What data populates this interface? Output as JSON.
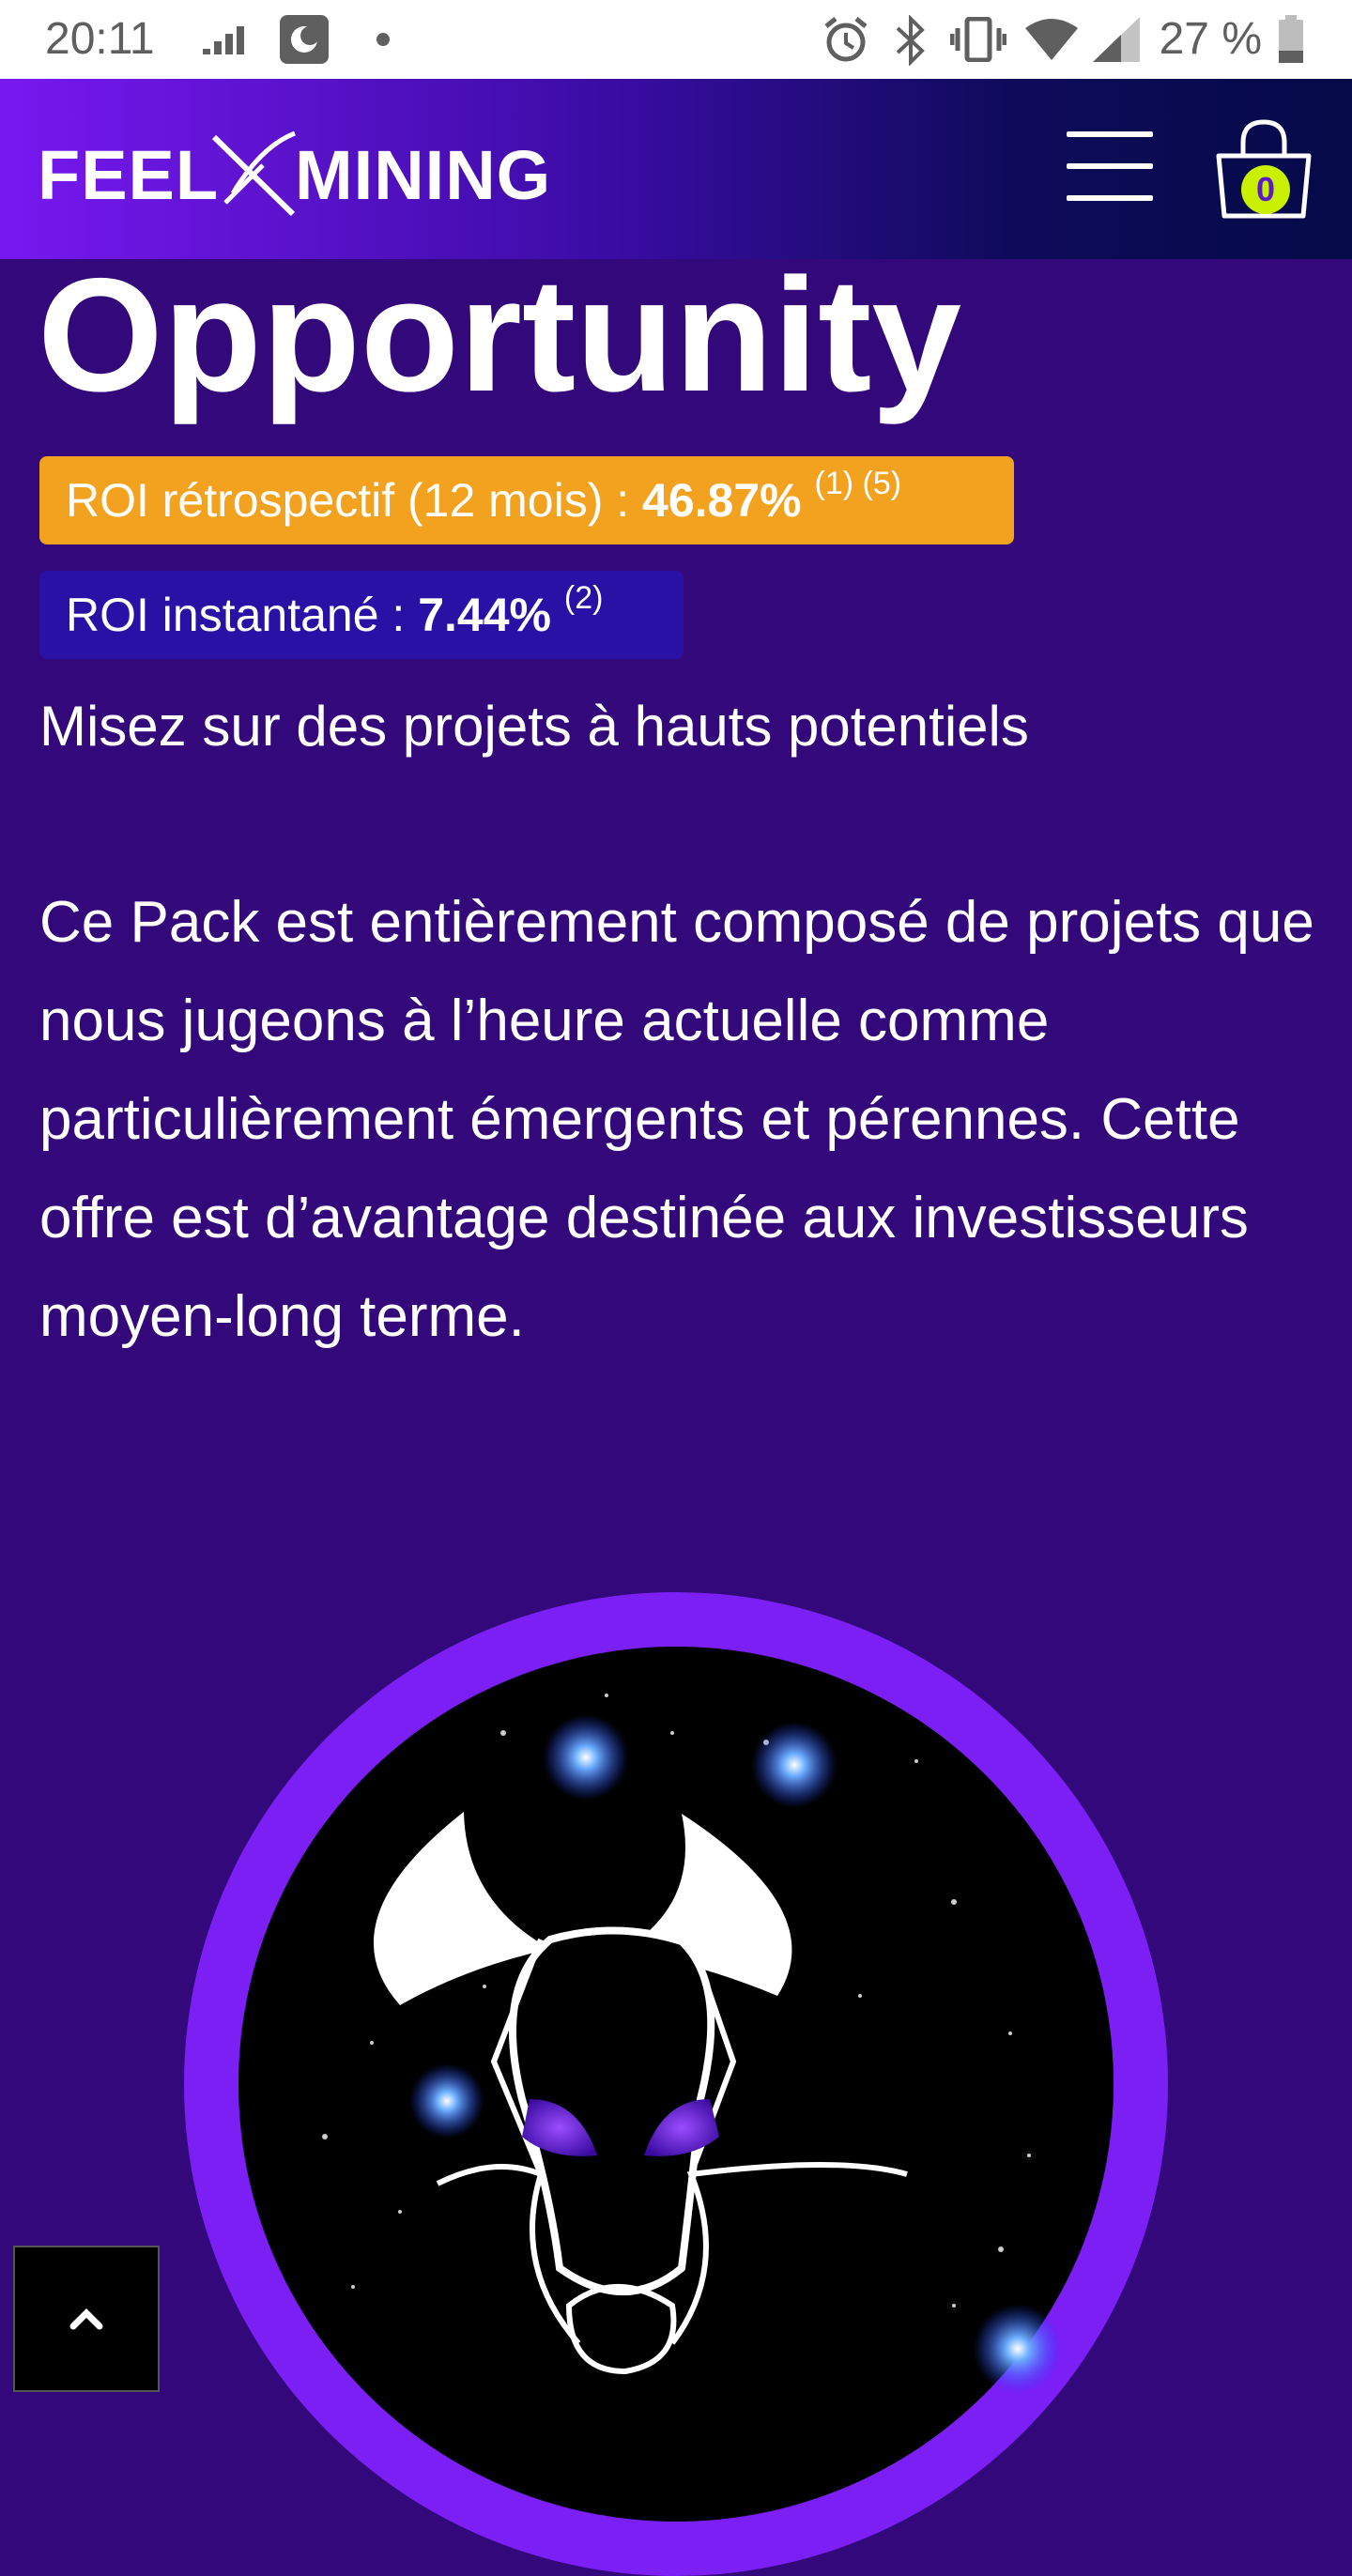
{
  "status_bar": {
    "time": "20:11",
    "battery_percent": "27 %",
    "icons": [
      "signal-bars-icon",
      "app-icon",
      "dot-icon",
      "alarm-icon",
      "bluetooth-icon",
      "vibrate-icon",
      "wifi-icon",
      "cell-signal-icon",
      "battery-icon"
    ]
  },
  "header": {
    "logo_left": "FEEL",
    "logo_right": "MINING",
    "cart_count": "0"
  },
  "main": {
    "title": "Opportunity",
    "roi_retro": {
      "label": "ROI rétrospectif (12 mois) : ",
      "value": "46.87%",
      "notes": "(1) (5)"
    },
    "roi_instant": {
      "label": "ROI instantané : ",
      "value": "7.44%",
      "notes": "(2)"
    },
    "subtitle": "Misez sur des projets à hauts potentiels",
    "description": "Ce Pack est entièrement composé de projets que nous jugeons à l’heure actuelle comme particulièrement émergents et pérennes. Cette offre est d’avantage destinée aux investisseurs moyen-long terme."
  },
  "colors": {
    "background": "#33087a",
    "roi_retro_bg": "#f3a21f",
    "roi_instant_bg": "#2a11a6",
    "badge": "#c8f000",
    "ring": "#7b1ff5"
  }
}
